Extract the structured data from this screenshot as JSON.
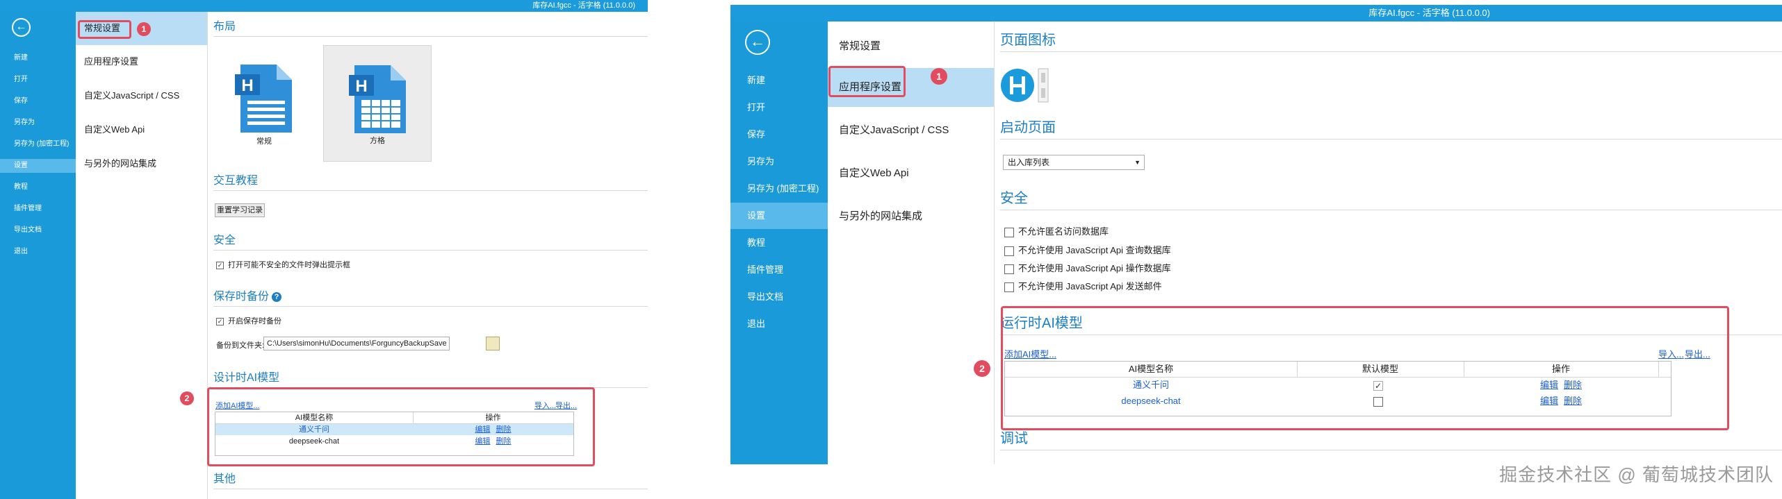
{
  "left": {
    "title": "库存AI.fgcc - 活字格 (11.0.0.0)",
    "back_glyph": "←",
    "nav": [
      "新建",
      "打开",
      "保存",
      "另存为",
      "另存为 (加密工程)",
      "设置",
      "教程",
      "插件管理",
      "导出文档",
      "退出"
    ],
    "nav_active": "设置",
    "subnav": [
      "常规设置",
      "应用程序设置",
      "自定义JavaScript / CSS",
      "自定义Web Api",
      "与另外的网站集成"
    ],
    "sections": {
      "layout": "布局",
      "tutorial": "交互教程",
      "security": "安全",
      "backup": "保存时备份",
      "ai": "设计时AI模型",
      "other": "其他"
    },
    "layout_options": [
      "常规",
      "方格"
    ],
    "reset_button": "重置学习记录",
    "security_check": "打开可能不安全的文件时弹出提示框",
    "backup_check": "开启保存时备份",
    "backup_label": "备份到文件夹:",
    "backup_path": "C:\\Users\\simonHu\\Documents\\ForguncyBackupSave",
    "add_model": "添加AI模型...",
    "import": "导入...",
    "export": "导出...",
    "grid_headers": [
      "AI模型名称",
      "操作"
    ],
    "models": [
      {
        "name": "通义千问",
        "edit": "编辑",
        "delete": "删除"
      },
      {
        "name": "deepseek-chat",
        "edit": "编辑",
        "delete": "删除"
      }
    ],
    "badge1": "1",
    "badge2": "2"
  },
  "right": {
    "title": "库存AI.fgcc - 活字格 (11.0.0.0)",
    "back_glyph": "←",
    "nav": [
      "新建",
      "打开",
      "保存",
      "另存为",
      "另存为 (加密工程)",
      "设置",
      "教程",
      "插件管理",
      "导出文档",
      "退出"
    ],
    "subnav": [
      "常规设置",
      "应用程序设置",
      "自定义JavaScript / CSS",
      "自定义Web Api",
      "与另外的网站集成"
    ],
    "sections": {
      "page_icon": "页面图标",
      "start_page": "启动页面",
      "security": "安全",
      "ai": "运行时AI模型",
      "debug": "调试"
    },
    "start_page_value": "出入库列表",
    "security_checks": [
      "不允许匿名访问数据库",
      "不允许使用 JavaScript Api 查询数据库",
      "不允许使用 JavaScript Api 操作数据库",
      "不允许使用 JavaScript Api 发送邮件"
    ],
    "add_model": "添加AI模型...",
    "import": "导入...",
    "export": "导出...",
    "grid_headers": [
      "AI模型名称",
      "默认模型",
      "操作"
    ],
    "models": [
      {
        "name": "通义千问",
        "default_mark": "✓",
        "edit": "编辑",
        "delete": "删除"
      },
      {
        "name": "deepseek-chat",
        "default_mark": "",
        "edit": "编辑",
        "delete": "删除"
      }
    ],
    "badge1": "1",
    "badge2": "2"
  },
  "watermark": "掘金技术社区 @ 葡萄城技术团队",
  "colors": {
    "accent": "#1c9bdc",
    "annotation": "#e14c5e",
    "section_title": "#1c7fc4"
  }
}
